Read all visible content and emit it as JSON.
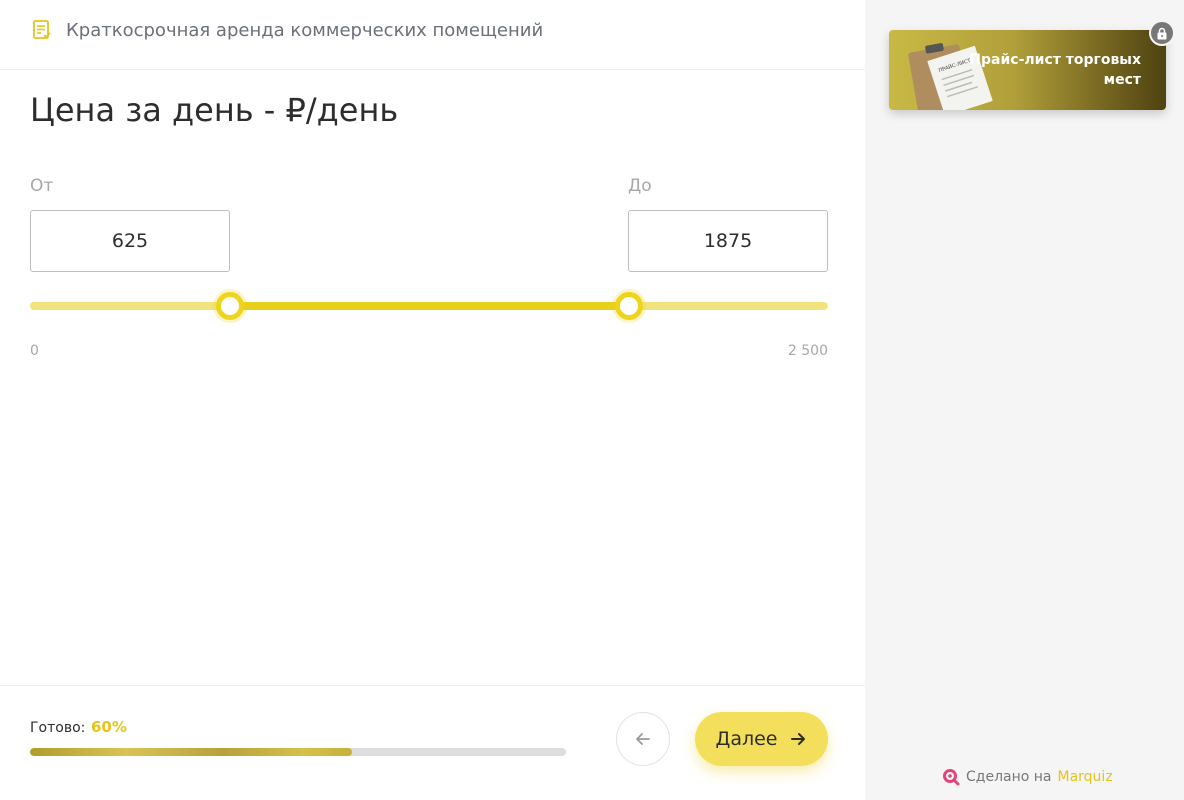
{
  "header": {
    "title": "Краткосрочная аренда коммерческих помещений",
    "icon": "form-icon"
  },
  "question": {
    "title": "Цена за день - ₽/день",
    "from_label": "От",
    "to_label": "До",
    "from_value": "625",
    "to_value": "1875",
    "slider": {
      "min": 0,
      "max": 2500,
      "low": 625,
      "high": 1875,
      "min_label": "0",
      "max_label": "2 500"
    }
  },
  "footer": {
    "progress_label": "Готово:",
    "progress_value": "60%",
    "progress_fraction": 0.6,
    "back_icon": "arrow-left-icon",
    "next_label": "Далее",
    "next_icon": "arrow-right-icon"
  },
  "sidebar": {
    "bonus_title": "Прайс-лист торговых мест",
    "bonus_image_text": "ПРАЙС-ЛИСТ",
    "made_with_prefix": "Сделано на",
    "made_with_brand": "Marquiz"
  },
  "colors": {
    "accent": "#eed41c",
    "button": "#f4df5c",
    "progress_value": "#e3c51b",
    "sidebar_bg": "#f5f5f5"
  }
}
